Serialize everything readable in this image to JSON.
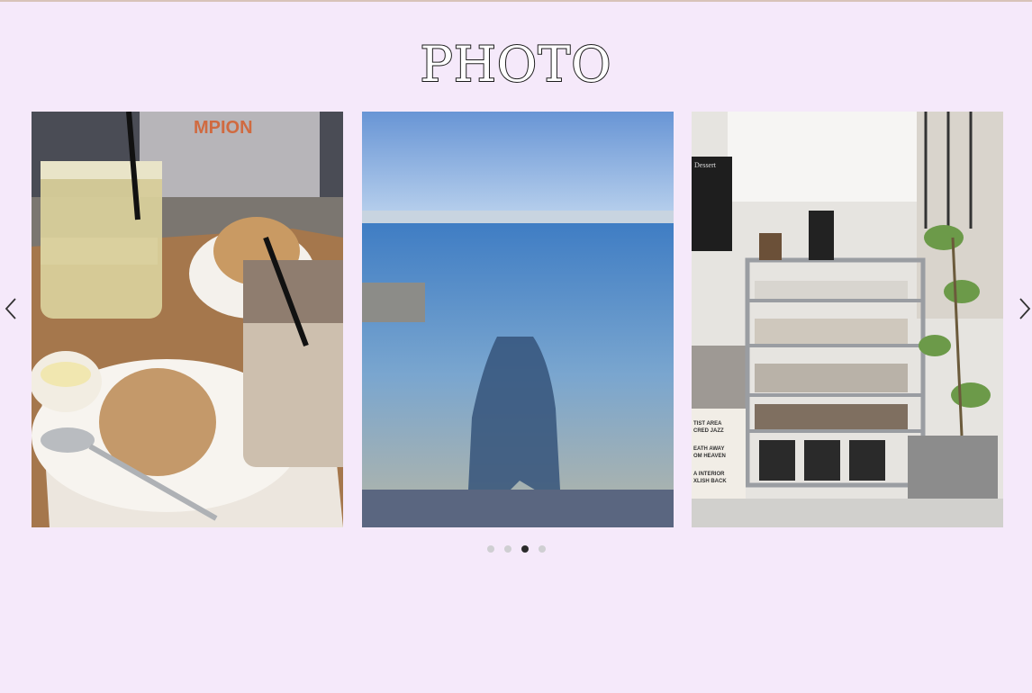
{
  "section": {
    "title": "PHOTO"
  },
  "carousel": {
    "prev_icon": "chevron-left-icon",
    "next_icon": "chevron-right-icon",
    "active_index": 2,
    "dot_count": 4,
    "slides": [
      {
        "name": "cafe-drinks-scones-photo",
        "shirt_text": "MPION"
      },
      {
        "name": "beach-shadow-photo"
      },
      {
        "name": "coffee-shop-shelf-photo",
        "board_text": "Dessert",
        "box_lines": [
          "TIST AREA",
          "CRED JAZZ",
          "EATH AWAY",
          "OM HEAVEN",
          "A INTERIOR",
          "XLISH BACK"
        ]
      }
    ]
  },
  "colors": {
    "background": "#f5e9fa",
    "dot_active": "#2b2b2b",
    "dot_inactive": "#cfcfd2"
  }
}
